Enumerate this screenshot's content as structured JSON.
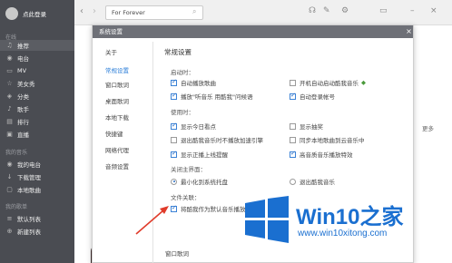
{
  "sidebar": {
    "user_name": "点此登录",
    "sections": {
      "online": "在线",
      "my_music": "我的音乐",
      "playlists": "我的歌单"
    },
    "online_items": [
      {
        "label": "推荐",
        "icon": "music-note-icon"
      },
      {
        "label": "电台",
        "icon": "radio-icon"
      },
      {
        "label": "MV",
        "icon": "tv-icon"
      },
      {
        "label": "美女秀",
        "icon": "star-icon"
      },
      {
        "label": "分类",
        "icon": "category-icon"
      },
      {
        "label": "歌手",
        "icon": "mic-icon"
      },
      {
        "label": "排行",
        "icon": "chart-icon"
      },
      {
        "label": "直播",
        "icon": "live-icon"
      }
    ],
    "my_items": [
      {
        "label": "我的电台",
        "icon": "radio-icon"
      },
      {
        "label": "下载管理",
        "icon": "download-icon"
      },
      {
        "label": "本地歌曲",
        "icon": "folder-icon"
      }
    ],
    "playlist_items": [
      {
        "label": "默认列表",
        "icon": "list-icon"
      },
      {
        "label": "新建列表",
        "icon": "add-icon"
      }
    ]
  },
  "topbar": {
    "back": "‹",
    "forward": "›",
    "search_value": "For Forever",
    "icons": [
      "headphones-icon",
      "skin-icon",
      "gear-icon",
      "mini-mode-icon",
      "minimize-icon",
      "close-icon"
    ]
  },
  "main": {
    "more": "更多"
  },
  "dialog": {
    "title": "系统设置",
    "close": "×",
    "nav": [
      "关于",
      "常规设置",
      "窗口歌词",
      "桌面歌词",
      "本地下载",
      "快捷键",
      "网络代理",
      "音频设置"
    ],
    "active_nav": 1,
    "panel_title": "常规设置",
    "startup": {
      "label": "启动时：",
      "auto_play": "自动播放歌曲",
      "auto_start": "开机自动启动酷我音乐",
      "play_greeting": "播放\"听音乐 用酷我\"问候语",
      "auto_login": "自动登录帐号"
    },
    "usage": {
      "label": "使用时：",
      "show_today": "显示今日看点",
      "show_lyrics": "显示抽奖",
      "exit_player_pop": "退出酷我音乐时不播放加速引擎",
      "sync_cloud": "同步本地歌曲到云音乐中",
      "show_top_hint": "显示正播上线提醒",
      "high_quality": "高音质音乐播放特效"
    },
    "close_panel": {
      "label": "关闭主界面：",
      "minimize_tray": "最小化到系统托盘",
      "exit_app": "退出酷我音乐"
    },
    "file_assoc": {
      "label": "文件关联：",
      "default_player": "将酷我作为默认音乐播放器"
    },
    "hotkey_section": "窗口歌词"
  },
  "watermark": {
    "brand": "Win10之家",
    "url": "www.win10xitong.com"
  },
  "colors": {
    "accent": "#2b7ed8",
    "sidebar": "#4a4c52",
    "watermark": "#1a6fd0",
    "arrow": "#e03b2a"
  }
}
